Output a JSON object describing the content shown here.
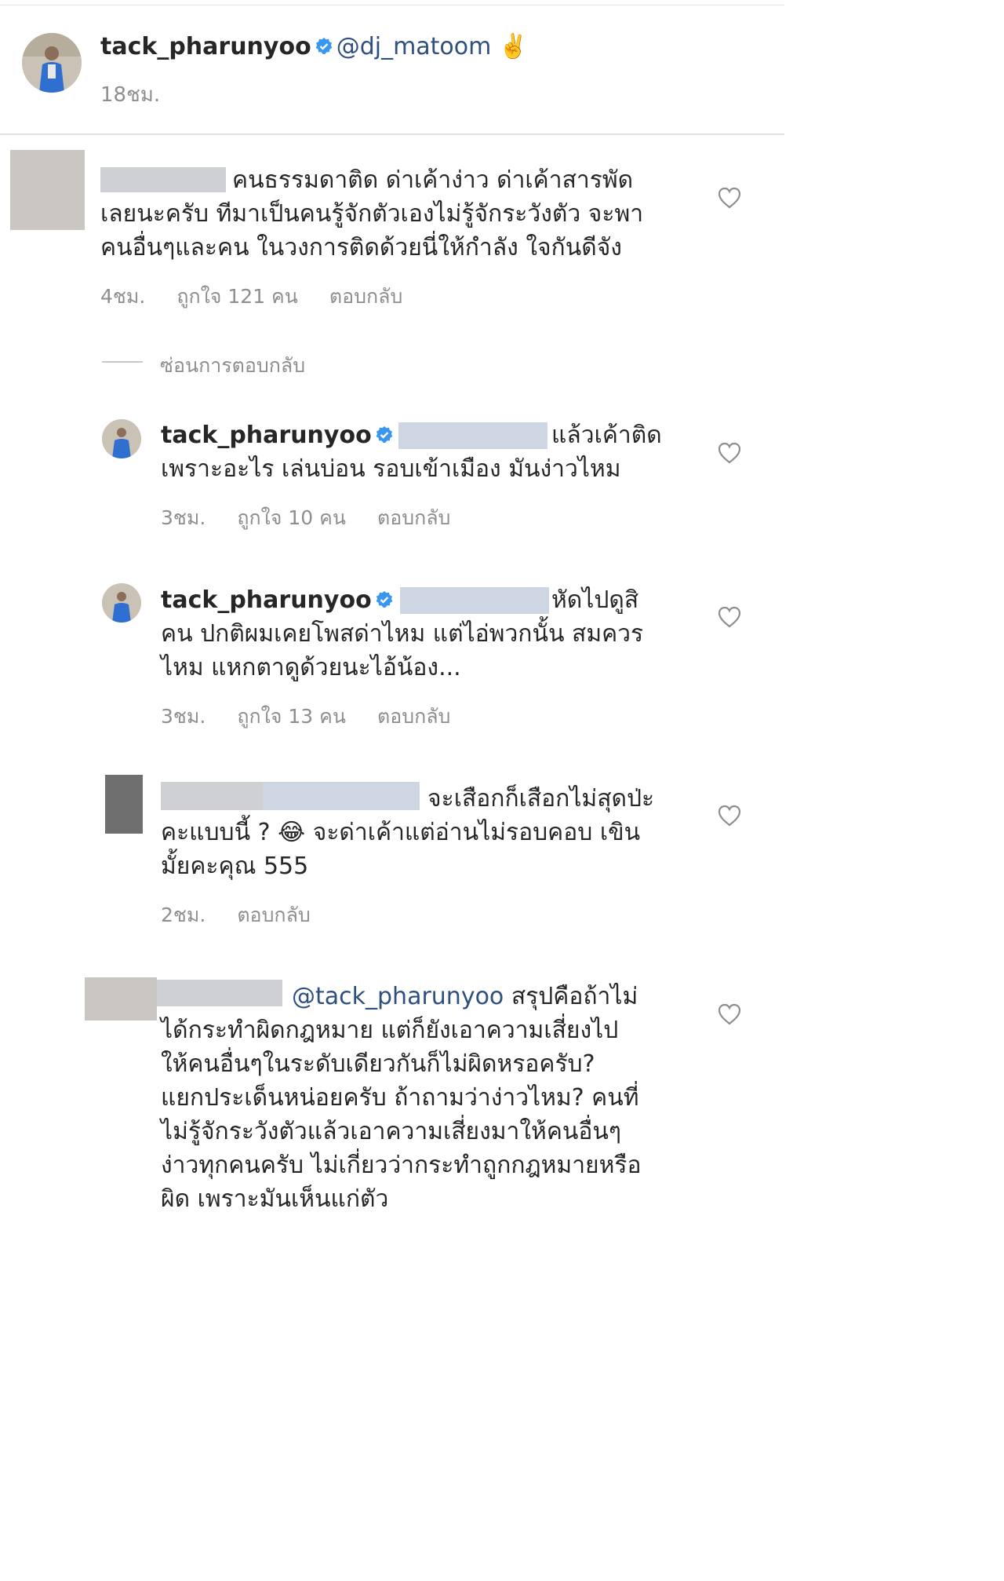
{
  "post": {
    "username": "tack_pharunyoo",
    "mention": "@dj_matoom",
    "emoji": "✌️",
    "time": "18ชม."
  },
  "comments": [
    {
      "lines": [
        "คนธรรมดาติด ด่าเค้าง่าว ด่าเค้าสารพัด",
        "เลยนะครับ ทีมาเป็นคนรู้จักตัวเองไม่รู้จักระวังตัว จะพา",
        "คนอื่นๆและคน ในวงการติดด้วยนี่ให้กำลัง ใจกันดีจัง"
      ],
      "time": "4ชม.",
      "likes": "ถูกใจ 121 คน",
      "reply": "ตอบกลับ",
      "hide_replies": "ซ่อนการตอบกลับ"
    },
    {
      "username": "tack_pharunyoo",
      "lines": [
        "แล้วเค้าติด",
        "เพราะอะไร เล่นบ่อน รอบเข้าเมือง มันง่าวไหม"
      ],
      "time": "3ชม.",
      "likes": "ถูกใจ 10 คน",
      "reply": "ตอบกลับ"
    },
    {
      "username": "tack_pharunyoo",
      "lines": [
        "หัดไปดูสิ",
        "คน ปกติผมเคยโพสด่าไหม แต่ไอ่พวกนั้น สมควร",
        "ไหม แหกตาดูด้วยนะไอ้น้อง..."
      ],
      "time": "3ชม.",
      "likes": "ถูกใจ 13 คน",
      "reply": "ตอบกลับ"
    },
    {
      "lines": [
        "จะเสือกก็เสือกไม่สุดป่ะ",
        "คะแบบนี้ ?",
        "จะด่าเค้าแต่อ่านไม่รอบคอบ เขิน",
        "มั้ยคะคุณ 555"
      ],
      "emoji": "😂",
      "time": "2ชม.",
      "reply": "ตอบกลับ"
    },
    {
      "mention": "@tack_pharunyoo",
      "lines": [
        "สรุปคือถ้าไม่",
        "ได้กระทำผิดกฎหมาย แต่ก็ยังเอาความเสี่ยงไป",
        "ให้คนอื่นๆในระดับเดียวกันก็ไม่ผิดหรอครับ?",
        "แยกประเด็นหน่อยครับ ถ้าถามว่าง่าวไหม? คนที่",
        "ไม่รู้จักระวังตัวแล้วเอาความเสี่ยงมาให้คนอื่นๆ",
        "ง่าวทุกคนครับ ไม่เกี่ยวว่ากระทำถูกกฎหมายหรือ",
        "ผิด เพราะมันเห็นแก่ตัว"
      ]
    }
  ],
  "colors": {
    "verified": "#3897f0",
    "meta": "#8e8e8e",
    "mention": "#2f4f7f"
  }
}
